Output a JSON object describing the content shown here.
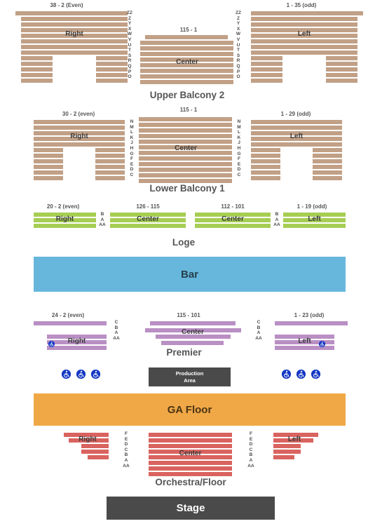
{
  "venue_map": {
    "sections": [
      {
        "id": "upper-balcony-2",
        "title": "Upper Balcony 2",
        "color": "#c1a086",
        "blocks": [
          {
            "id": "ub2-right",
            "label": "Right",
            "range": "38 - 2 (Even)"
          },
          {
            "id": "ub2-center",
            "label": "Center",
            "range": "115 - 1"
          },
          {
            "id": "ub2-left",
            "label": "Left",
            "range": "1 - 35 (odd)"
          }
        ],
        "row_letters": [
          "ZZ",
          "Z",
          "Y",
          "X",
          "W",
          "V",
          "U",
          "T",
          "S",
          "R",
          "Q",
          "P",
          "O"
        ]
      },
      {
        "id": "lower-balcony-1",
        "title": "Lower Balcony 1",
        "color": "#c1a086",
        "blocks": [
          {
            "id": "lb1-right",
            "label": "Right",
            "range": "30 - 2 (even)"
          },
          {
            "id": "lb1-center",
            "label": "Center",
            "range": "115 - 1"
          },
          {
            "id": "lb1-left",
            "label": "Left",
            "range": "1 - 29 (odd)"
          }
        ],
        "row_letters": [
          "N",
          "M",
          "L",
          "K",
          "J",
          "H",
          "G",
          "F",
          "E",
          "D",
          "C"
        ]
      },
      {
        "id": "loge",
        "title": "Loge",
        "color": "#a6ce54",
        "blocks": [
          {
            "id": "loge-right",
            "label": "Right",
            "range": "20 - 2 (even)"
          },
          {
            "id": "loge-center-1",
            "label": "Center",
            "range": "126 - 115"
          },
          {
            "id": "loge-center-2",
            "label": "Center",
            "range": "112 - 101"
          },
          {
            "id": "loge-left",
            "label": "Left",
            "range": "1 - 19 (odd)"
          }
        ],
        "row_letters": [
          "B",
          "A",
          "AA"
        ]
      },
      {
        "id": "bar",
        "title": "Bar",
        "color": "#67b7dd",
        "blocks": [],
        "row_letters": []
      },
      {
        "id": "premier",
        "title": "Premier",
        "color": "#b98fc4",
        "blocks": [
          {
            "id": "premier-right",
            "label": "Right",
            "range": "24 - 2 (even)"
          },
          {
            "id": "premier-center",
            "label": "Center",
            "range": "115 - 101"
          },
          {
            "id": "premier-left",
            "label": "Left",
            "range": "1 - 23 (odd)"
          }
        ],
        "row_letters": [
          "C",
          "B",
          "A",
          "AA"
        ]
      },
      {
        "id": "ga-floor",
        "title": "GA Floor",
        "color": "#f0a847",
        "blocks": [],
        "row_letters": []
      },
      {
        "id": "orchestra-floor",
        "title": "Orchestra/Floor",
        "color": "#d9635f",
        "blocks": [
          {
            "id": "orch-right",
            "label": "Right",
            "range": ""
          },
          {
            "id": "orch-center",
            "label": "Center",
            "range": ""
          },
          {
            "id": "orch-left",
            "label": "Left",
            "range": ""
          }
        ],
        "row_letters": [
          "F",
          "E",
          "D",
          "C",
          "B",
          "A",
          "AA"
        ]
      }
    ],
    "production_area": {
      "line1": "Production",
      "line2": "Area"
    },
    "stage": {
      "label": "Stage",
      "color": "#4a4a4a"
    },
    "accessible_icon_name": "wheelchair-accessible-icon",
    "accessible_icon_color": "#1437c4",
    "accessible_seat_counts": {
      "left_of_production": 3,
      "right_of_production": 3,
      "premier_right": 1,
      "premier_left": 1
    }
  }
}
